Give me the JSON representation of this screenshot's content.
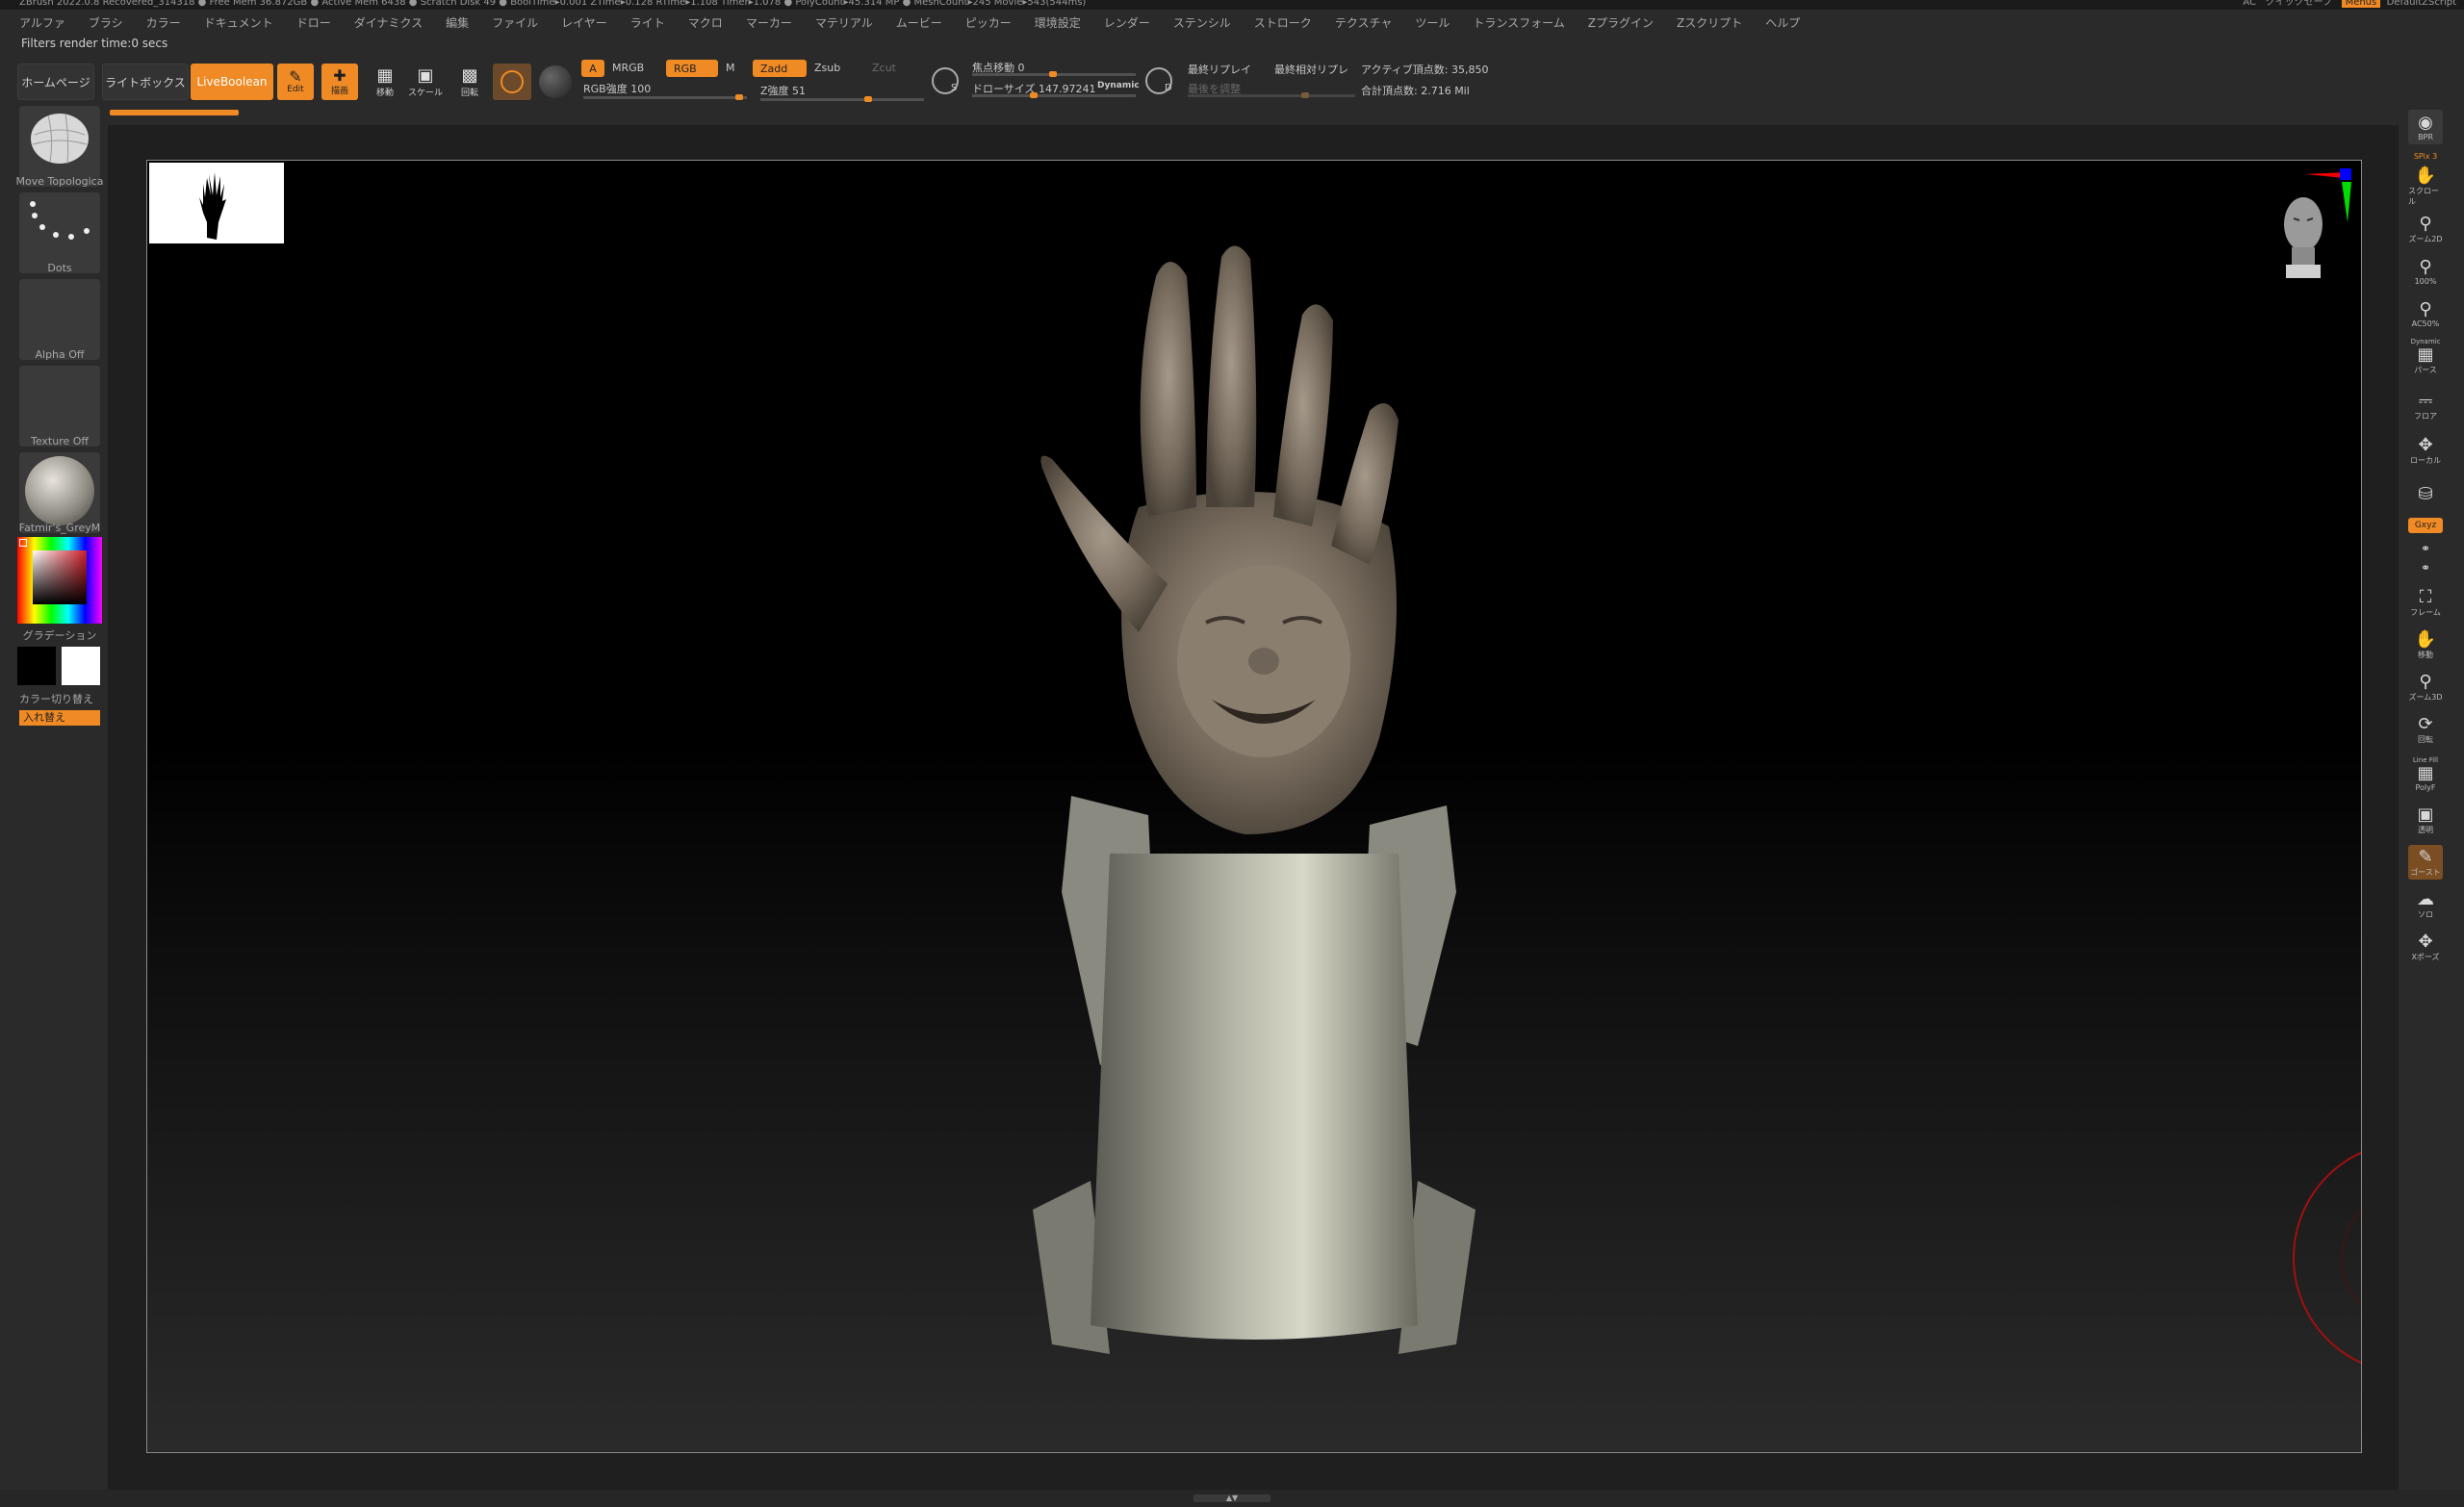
{
  "titlebar": {
    "left": "ZBrush 2022.0.8   Recovered_314318   ● Free Mem 36.872GB ● Active Mem 6438 ● Scratch Disk 49 ● BoolTime▸0.001 ZTime▸0.128 RTime▸1.108 Timer▸1.078 ● PolyCount▸45.314 MP ● MeshCount▸245 Movie▸543(544ms)",
    "right_ac": "AC",
    "right_quicksave": "クイックセーブ",
    "right_menu": "Menus",
    "right_script": "DefaultZScript"
  },
  "menu": [
    "アルファ",
    "ブラシ",
    "カラー",
    "ドキュメント",
    "ドロー",
    "ダイナミクス",
    "編集",
    "ファイル",
    "レイヤー",
    "ライト",
    "マクロ",
    "マーカー",
    "マテリアル",
    "ムービー",
    "ピッカー",
    "環境設定",
    "レンダー",
    "ステンシル",
    "ストローク",
    "テクスチャ",
    "ツール",
    "トランスフォーム",
    "Zプラグイン",
    "Zスクリプト",
    "ヘルプ"
  ],
  "filter_status": "Filters render time:0 secs",
  "toolbar": {
    "home": "ホームページ",
    "lightbox": "ライトボックス",
    "liveboolean": "LiveBoolean",
    "edit": "Edit",
    "draw": "描画",
    "move": "移動",
    "scale": "スケール",
    "rotate": "回転",
    "a": "A",
    "mrgb": "MRGB",
    "rgb": "RGB",
    "m": "M",
    "zadd": "Zadd",
    "zsub": "Zsub",
    "zcut": "Zcut",
    "rgb_intensity_label": "RGB強度",
    "rgb_intensity_value": "100",
    "z_intensity_label": "Z強度",
    "z_intensity_value": "51",
    "focal_shift_label": "焦点移動",
    "focal_shift_value": "0",
    "draw_size_label": "ドローサイズ",
    "draw_size_value": "147.97241",
    "dynamic": "Dynamic",
    "s_label": "S",
    "d_label": "D",
    "replay_last": "最終リプレイ",
    "replay_last_rel": "最終相対リプレ",
    "adjust_last": "最後を調整",
    "active_points": "アクティブ頂点数: 35,850",
    "total_points": "合計頂点数: 2.716 Mil"
  },
  "lefttray": {
    "brush": "Move Topologica",
    "stroke": "Dots",
    "alpha": "Alpha Off",
    "texture": "Texture Off",
    "material": "Fatmir's_GreyM",
    "gradient": "グラデーション",
    "switch_color": "カラー切り替え",
    "swap": "入れ替え"
  },
  "righttray": {
    "bpr": "BPR",
    "spix_label": "SPix",
    "spix_value": "3",
    "scroll": "スクロール",
    "zoom2d": "ズーム2D",
    "p100": "100%",
    "ac50": "AC50%",
    "dynamic": "Dynamic",
    "perspective": "パース",
    "floor": "フロア",
    "local": "ローカル",
    "lock": "🔒",
    "xyz": "Gxyz",
    "frame": "フレーム",
    "move": "移動",
    "zoom3d": "ズーム3D",
    "rotate": "回転",
    "linefill": "Line Fill",
    "polyf": "PolyF",
    "transp": "透明",
    "ghost": "ゴースト",
    "solo": "ソロ",
    "xpose": "Xポーズ"
  },
  "colors": {
    "accent": "#f08a24",
    "canvas_top": "#000000",
    "canvas_bottom": "#2a2a2a",
    "bg": "#2a2a2a"
  }
}
